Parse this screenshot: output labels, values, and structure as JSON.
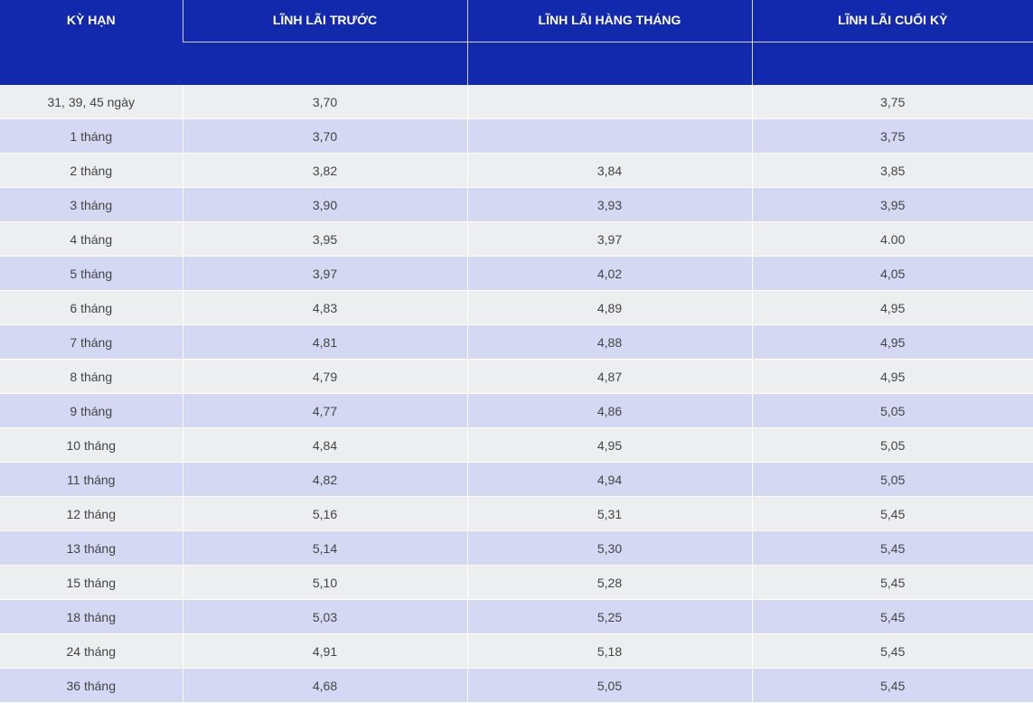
{
  "table": {
    "headers": {
      "ky_han": "KỲ HẠN",
      "linh_lai_truoc": "LĨNH LÃI TRƯỚC",
      "linh_lai_hang_thang": "LĨNH LÃI HÀNG THÁNG",
      "linh_lai_cuoi_ky": "LĨNH LÃI CUỐI KỲ"
    },
    "rows": [
      {
        "term": "31, 39, 45 ngày",
        "prepaid": "3,70",
        "monthly": "",
        "maturity": "3,75"
      },
      {
        "term": "1 tháng",
        "prepaid": "3,70",
        "monthly": "",
        "maturity": "3,75"
      },
      {
        "term": "2 tháng",
        "prepaid": "3,82",
        "monthly": "3,84",
        "maturity": "3,85"
      },
      {
        "term": "3 tháng",
        "prepaid": "3,90",
        "monthly": "3,93",
        "maturity": "3,95"
      },
      {
        "term": "4 tháng",
        "prepaid": "3,95",
        "monthly": "3,97",
        "maturity": "4.00"
      },
      {
        "term": "5 tháng",
        "prepaid": "3,97",
        "monthly": "4,02",
        "maturity": "4,05"
      },
      {
        "term": "6 tháng",
        "prepaid": "4,83",
        "monthly": "4,89",
        "maturity": "4,95"
      },
      {
        "term": "7 tháng",
        "prepaid": "4,81",
        "monthly": "4,88",
        "maturity": "4,95"
      },
      {
        "term": "8 tháng",
        "prepaid": "4,79",
        "monthly": "4,87",
        "maturity": "4,95"
      },
      {
        "term": "9 tháng",
        "prepaid": "4,77",
        "monthly": "4,86",
        "maturity": "5,05"
      },
      {
        "term": "10 tháng",
        "prepaid": "4,84",
        "monthly": "4,95",
        "maturity": "5,05"
      },
      {
        "term": "11 tháng",
        "prepaid": "4,82",
        "monthly": "4,94",
        "maturity": "5,05"
      },
      {
        "term": "12 tháng",
        "prepaid": "5,16",
        "monthly": "5,31",
        "maturity": "5,45"
      },
      {
        "term": "13 tháng",
        "prepaid": "5,14",
        "monthly": "5,30",
        "maturity": "5,45"
      },
      {
        "term": "15 tháng",
        "prepaid": "5,10",
        "monthly": "5,28",
        "maturity": "5,45"
      },
      {
        "term": "18 tháng",
        "prepaid": "5,03",
        "monthly": "5,25",
        "maturity": "5,45"
      },
      {
        "term": "24 tháng",
        "prepaid": "4,91",
        "monthly": "5,18",
        "maturity": "5,45"
      },
      {
        "term": "36 tháng",
        "prepaid": "4,68",
        "monthly": "5,05",
        "maturity": "5,45"
      }
    ]
  },
  "colors": {
    "header_bg": "#1229ad",
    "row_odd_bg": "#eceef0",
    "row_even_bg": "#d5d8f2",
    "cell_text": "#444444"
  }
}
